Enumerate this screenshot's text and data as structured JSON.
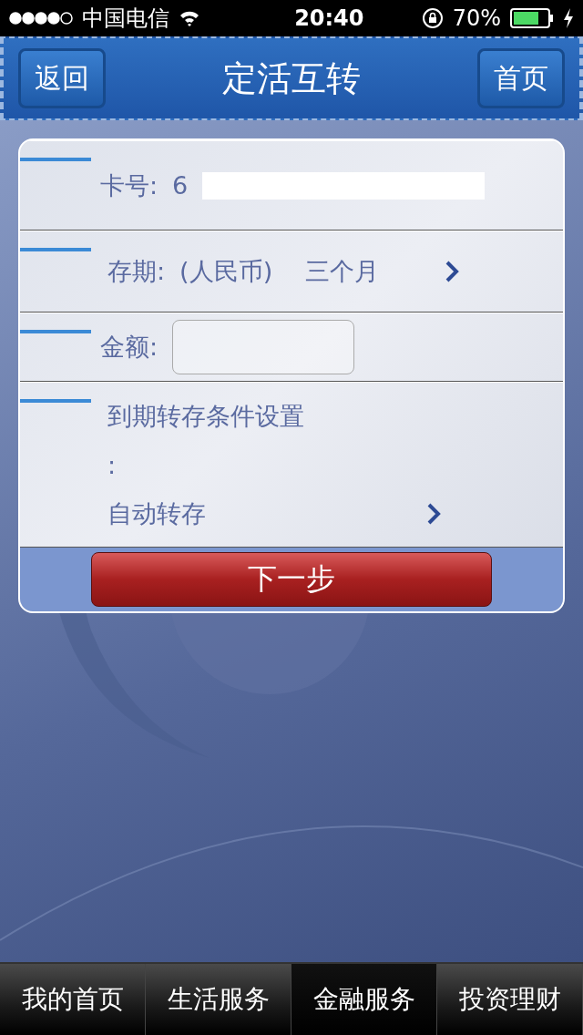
{
  "status_bar": {
    "carrier": "中国电信",
    "time": "20:40",
    "battery": "70%"
  },
  "header": {
    "back_button": "返回",
    "title": "定活互转",
    "home_button": "首页"
  },
  "form": {
    "rows": [
      {
        "kind": "display",
        "label": "卡号:",
        "value": "6",
        "redacted": true
      },
      {
        "kind": "picker",
        "label": "存期:",
        "values": [
          "(人民币)",
          "三个月"
        ]
      },
      {
        "kind": "input",
        "label": "金额:"
      },
      {
        "kind": "setting",
        "label_lines": [
          "到期转存条件设置",
          ":"
        ],
        "value": "自动转存"
      }
    ],
    "submit_button": "下一步"
  },
  "tabs": [
    {
      "label": "我的首页",
      "selected": false
    },
    {
      "label": "生活服务",
      "selected": false
    },
    {
      "label": "金融服务",
      "selected": true
    },
    {
      "label": "投资理财",
      "selected": false
    }
  ]
}
